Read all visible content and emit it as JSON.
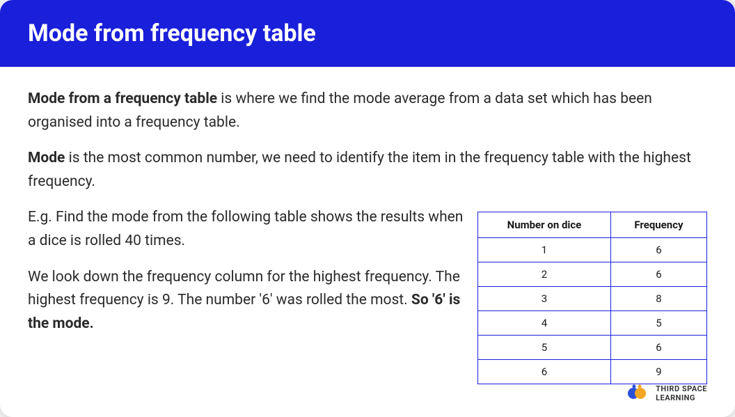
{
  "header": {
    "title": "Mode from frequency table"
  },
  "paragraphs": {
    "p1_bold": "Mode from a frequency table",
    "p1_rest": " is where we find the mode average from a data set which has been organised into a frequency table.",
    "p2_bold": "Mode",
    "p2_rest": " is the most common number, we need to identify the item in the frequency table with the highest frequency.",
    "p3": "E.g. Find the mode from the following table shows the results when a dice is rolled 40 times.",
    "p4_part1": "We look down the frequency column for the highest frequency. The highest frequency is 9.  The number '6' was rolled the most.  ",
    "p4_bold": "So '6' is the mode."
  },
  "table": {
    "headers": [
      "Number on dice",
      "Frequency"
    ],
    "rows": [
      [
        "1",
        "6"
      ],
      [
        "2",
        "6"
      ],
      [
        "3",
        "8"
      ],
      [
        "4",
        "5"
      ],
      [
        "5",
        "6"
      ],
      [
        "6",
        "9"
      ]
    ]
  },
  "logo": {
    "line1": "THIRD SPACE",
    "line2": "LEARNING"
  }
}
